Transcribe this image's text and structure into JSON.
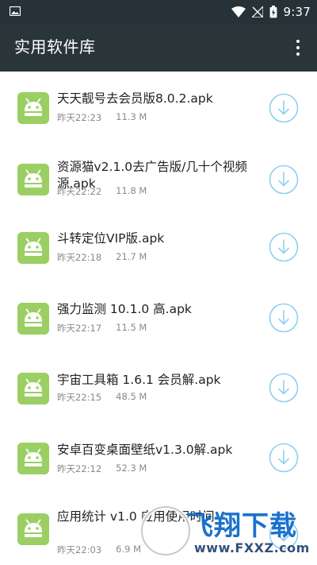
{
  "status_bar": {
    "time": "9:37"
  },
  "app_bar": {
    "title": "实用软件库"
  },
  "files": [
    {
      "name": "天天靓号去会员版8.0.2.apk",
      "time": "昨天22:23",
      "size": "11.3 M"
    },
    {
      "name": "资源猫v2.1.0去广告版/几十个视频源.apk",
      "time": "昨天22:22",
      "size": "11.8 M"
    },
    {
      "name": "斗转定位VIP版.apk",
      "time": "昨天22:18",
      "size": "21.7 M"
    },
    {
      "name": "强力监测 10.1.0 高.apk",
      "time": "昨天22:17",
      "size": "11.5 M"
    },
    {
      "name": "宇宙工具箱 1.6.1 会员解.apk",
      "time": "昨天22:15",
      "size": "48.5 M"
    },
    {
      "name": "安卓百变桌面壁纸v1.3.0解.apk",
      "time": "昨天22:12",
      "size": "52.3 M"
    },
    {
      "name": "应用统计 v1.0 应用使用时间",
      "time": "昨天22:03",
      "size": "6.9 M"
    }
  ],
  "watermark": {
    "brand": "飞翔下载",
    "url": "www.FXXZ.com"
  },
  "colors": {
    "status_bar": "#263238",
    "app_bar": "#2a3539",
    "android_icon": "#9bcf63",
    "download_icon": "#8fd0f0"
  }
}
